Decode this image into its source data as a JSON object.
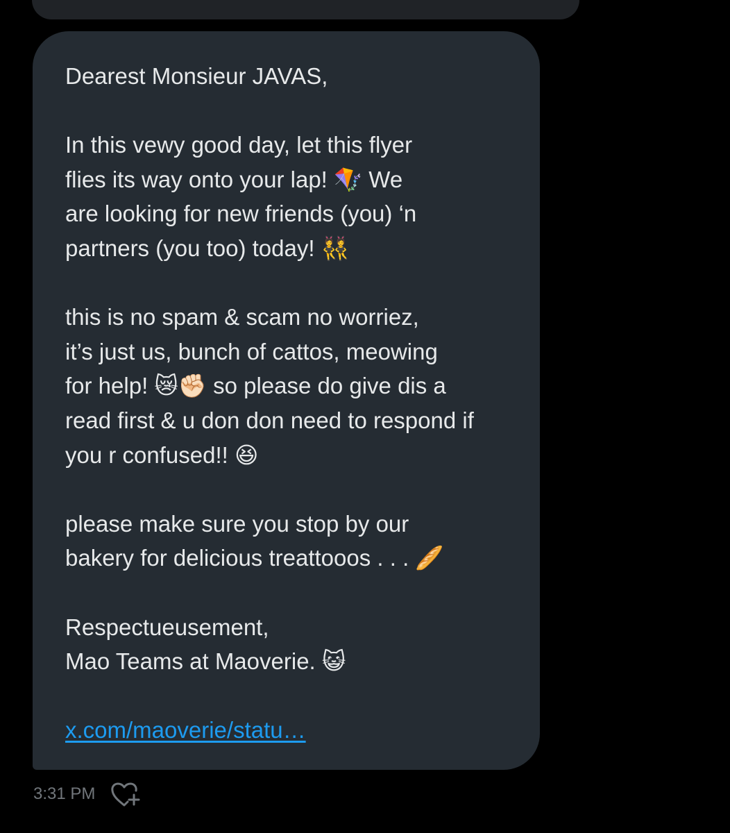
{
  "message": {
    "paragraphs": [
      [
        "Dearest Monsieur JAVAS,"
      ],
      [
        "In this vewy good day, let this flyer",
        "flies its way onto your lap! 🪁 We",
        "are looking for new friends (you) ‘n",
        "partners (you too) today! 👯"
      ],
      [
        "this is no spam & scam no worriez,",
        "it’s just us, bunch of cattos, meowing",
        "for help! 😿✊🏻 so please do give dis a",
        "read first & u don don need to respond if",
        "you r confused!! 😆"
      ],
      [
        "please make sure you stop by our",
        "bakery for delicious treattooos . . . 🥖"
      ],
      [
        "Respectueusement,",
        "Mao Teams at Maoverie. 😺"
      ]
    ],
    "link_text": "x.com/maoverie/statu…"
  },
  "meta": {
    "time": "3:31 PM",
    "reaction_icon": "heart-plus-icon"
  },
  "colors": {
    "background": "#000000",
    "bubble": "#252c33",
    "text": "#e7e9ea",
    "link": "#1d9bf0",
    "muted": "#71767b"
  }
}
